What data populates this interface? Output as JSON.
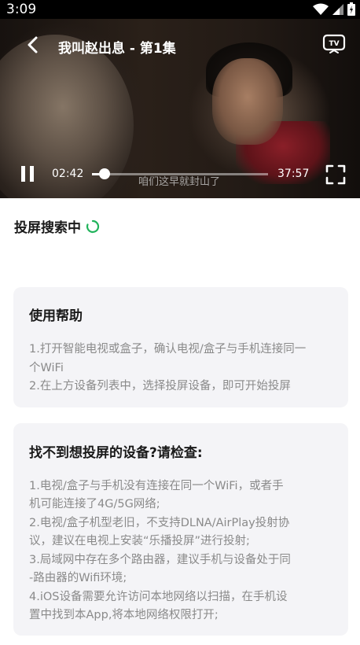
{
  "status_bar": {
    "time": "3:09"
  },
  "player": {
    "title": "我叫赵出息 - 第1集",
    "current_time": "02:42",
    "total_time": "37:57",
    "progress": 0.0712,
    "subtitle": "咱们这早就封山了"
  },
  "cast": {
    "searching_label": "投屏搜索中"
  },
  "help_card": {
    "title": "使用帮助",
    "lines": [
      "1.打开智能电视或盒子，确认电视/盒子与手机连接同一",
      "个WiFi",
      "2.在上方设备列表中，选择投屏设备，即可开始投屏"
    ]
  },
  "troubleshoot_card": {
    "title": "找不到想投屏的设备?请检查:",
    "lines": [
      "1.电视/盒子与手机没有连接在同一个WiFi，或者手",
      "机可能连接了4G/5G网络;",
      "2.电视/盒子机型老旧，不支持DLNA/AirPlay投射协",
      "议，建议在电视上安装“乐播投屏”进行投射;",
      "3.局域网中存在多个路由器，建议手机与设备处于同",
      "-路由器的Wifi环境;",
      "4.iOS设备需要允许访问本地网络以扫描，在手机设",
      "置中找到本App,将本地网络权限打开;"
    ]
  },
  "colors": {
    "accent": "#21b35b",
    "card_bg": "#f4f4f7",
    "muted_text": "#8a8a8a"
  }
}
